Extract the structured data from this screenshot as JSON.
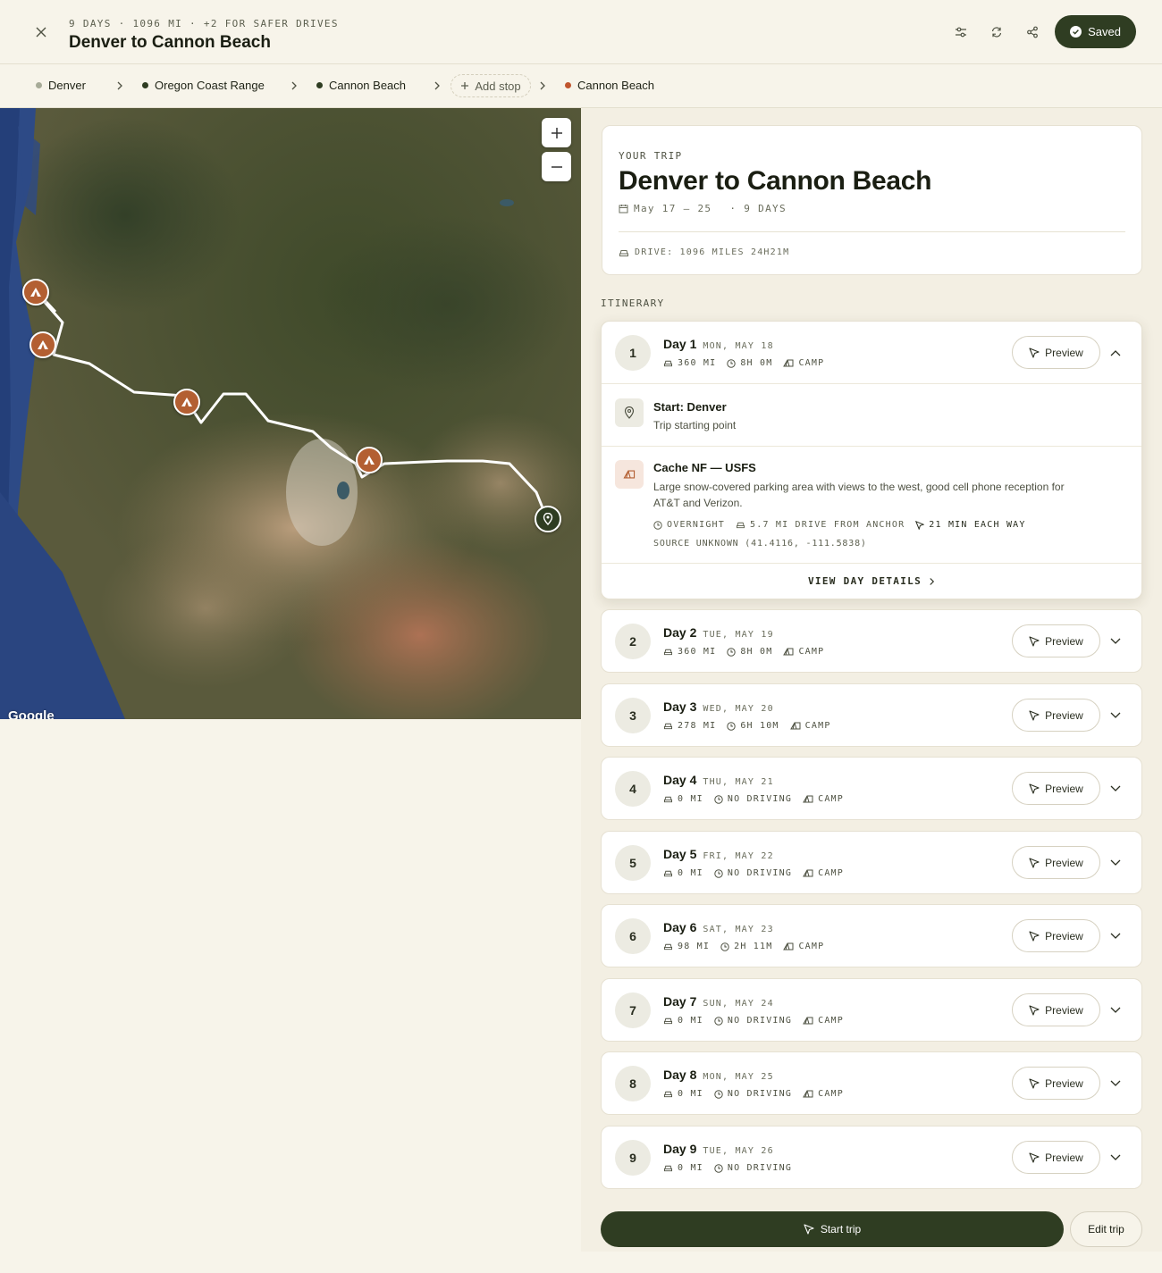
{
  "header": {
    "meta": "9 DAYS · 1096 MI · +2 FOR SAFER DRIVES",
    "title": "Denver to Cannon Beach",
    "saved_label": "Saved"
  },
  "stops": [
    {
      "label": "Denver",
      "color": "#a7ab98"
    },
    {
      "label": "Oregon Coast Range",
      "color": "#2f3d22"
    },
    {
      "label": "Cannon Beach",
      "color": "#2f3d22"
    },
    {
      "label": "Cannon Beach",
      "color": "#c0552e"
    }
  ],
  "add_stop_label": "Add stop",
  "map": {
    "logo": "Google",
    "zoom_in": "+",
    "zoom_out": "−"
  },
  "trip": {
    "eyebrow": "YOUR TRIP",
    "title": "Denver to Cannon Beach",
    "dates": "May 17 – 25",
    "days": "· 9 DAYS",
    "drive": "DRIVE: 1096 MILES 24H21M"
  },
  "itinerary_label": "ITINERARY",
  "days": [
    {
      "num": "1",
      "label": "Day 1",
      "date": "MON, MAY 18",
      "miles": "360 MI",
      "time": "8H 0M",
      "camp": "CAMP"
    },
    {
      "num": "2",
      "label": "Day 2",
      "date": "TUE, MAY 19",
      "miles": "360 MI",
      "time": "8H 0M",
      "camp": "CAMP"
    },
    {
      "num": "3",
      "label": "Day 3",
      "date": "WED, MAY 20",
      "miles": "278 MI",
      "time": "6H 10M",
      "camp": "CAMP"
    },
    {
      "num": "4",
      "label": "Day 4",
      "date": "THU, MAY 21",
      "miles": "0 MI",
      "time": "NO DRIVING",
      "camp": "CAMP"
    },
    {
      "num": "5",
      "label": "Day 5",
      "date": "FRI, MAY 22",
      "miles": "0 MI",
      "time": "NO DRIVING",
      "camp": "CAMP"
    },
    {
      "num": "6",
      "label": "Day 6",
      "date": "SAT, MAY 23",
      "miles": "98 MI",
      "time": "2H 11M",
      "camp": "CAMP"
    },
    {
      "num": "7",
      "label": "Day 7",
      "date": "SUN, MAY 24",
      "miles": "0 MI",
      "time": "NO DRIVING",
      "camp": "CAMP"
    },
    {
      "num": "8",
      "label": "Day 8",
      "date": "MON, MAY 25",
      "miles": "0 MI",
      "time": "NO DRIVING",
      "camp": "CAMP"
    },
    {
      "num": "9",
      "label": "Day 9",
      "date": "TUE, MAY 26",
      "miles": "0 MI",
      "time": "NO DRIVING",
      "camp": ""
    }
  ],
  "day1_detail": {
    "start_name": "Start: Denver",
    "start_desc": "Trip starting point",
    "camp_name": "Cache NF — USFS",
    "camp_desc": "Large snow-covered parking area with views to the west, good cell phone reception for AT&T and Verizon.",
    "overnight": "OVERNIGHT",
    "drive_from": "5.7 MI DRIVE FROM ANCHOR",
    "each_way": "21 MIN EACH WAY",
    "source": "SOURCE UNKNOWN (41.4116, -111.5838)",
    "view_details": "VIEW DAY DETAILS"
  },
  "preview_label": "Preview",
  "actions": {
    "start_trip": "Start trip",
    "edit_trip": "Edit trip"
  }
}
